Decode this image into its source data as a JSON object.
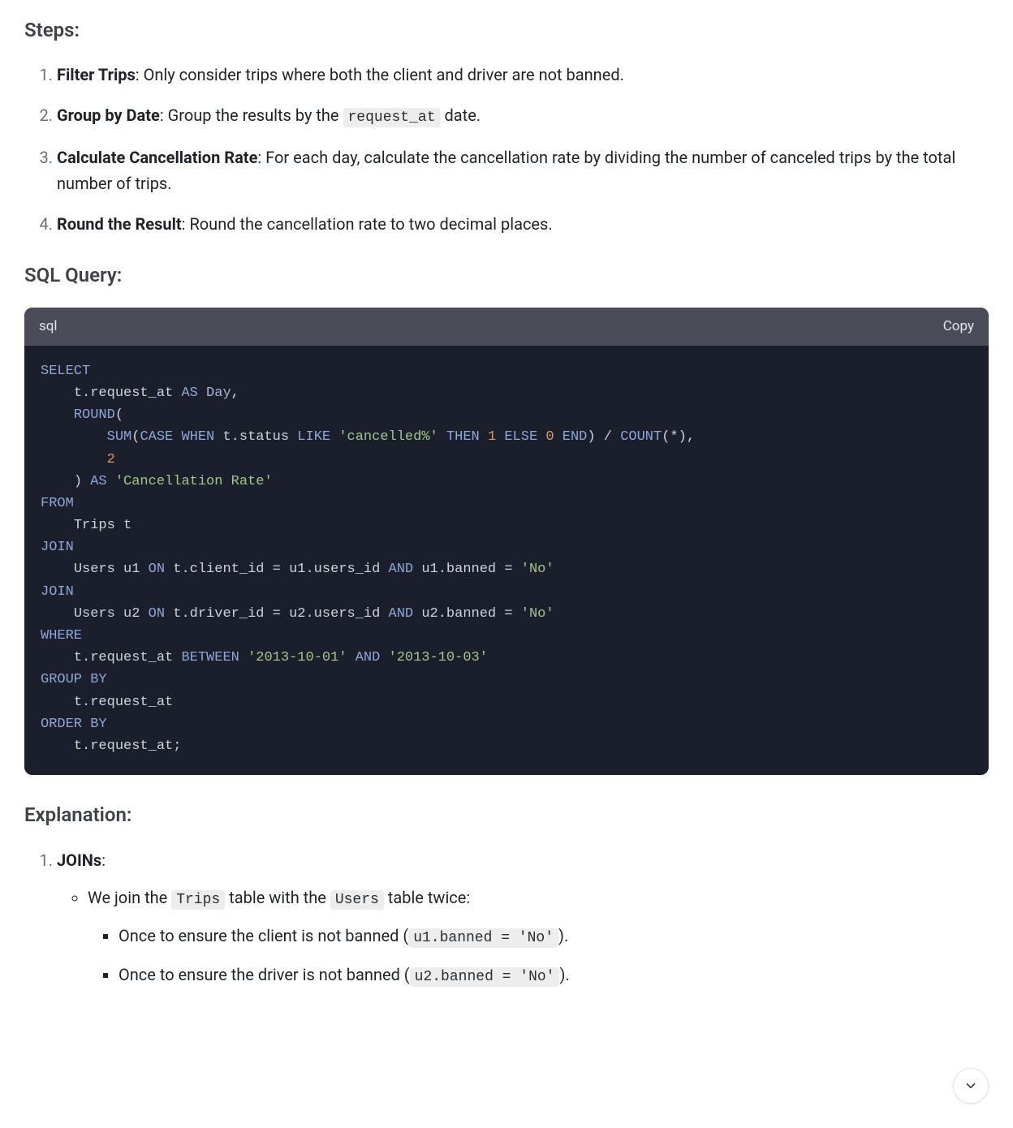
{
  "headings": {
    "steps": "Steps:",
    "sql_query": "SQL Query:",
    "explanation": "Explanation:"
  },
  "steps": [
    {
      "title": "Filter Trips",
      "rest": ": Only consider trips where both the client and driver are not banned."
    },
    {
      "title": "Group by Date",
      "prefix": ": Group the results by the ",
      "code": "request_at",
      "suffix": " date."
    },
    {
      "title": "Calculate Cancellation Rate",
      "rest": ": For each day, calculate the cancellation rate by dividing the number of canceled trips by the total number of trips."
    },
    {
      "title": "Round the Result",
      "rest": ": Round the cancellation rate to two decimal places."
    }
  ],
  "code": {
    "lang": "sql",
    "copy_label": "Copy",
    "tokens": {
      "select": "SELECT",
      "as1": "AS",
      "day": "Day",
      "round": "ROUND",
      "sum": "SUM",
      "case": "CASE",
      "when": "WHEN",
      "like": "LIKE",
      "then": "THEN",
      "else": "ELSE",
      "end": "END",
      "count": "COUNT",
      "from": "FROM",
      "join1": "JOIN",
      "on1": "ON",
      "and1": "AND",
      "join2": "JOIN",
      "on2": "ON",
      "and2": "AND",
      "where": "WHERE",
      "between": "BETWEEN",
      "and3": "AND",
      "groupby": "GROUP BY",
      "orderby": "ORDER BY",
      "t_request_at": "t.request_at",
      "t_status": "t.status",
      "trips": "Trips t",
      "users_u1": "Users u1",
      "users_u2": "Users u2",
      "t_client_id": "t.client_id",
      "u1_users_id": "u1.users_id",
      "u1_banned": "u1.banned",
      "t_driver_id": "t.driver_id",
      "u2_users_id": "u2.users_id",
      "u2_banned": "u2.banned",
      "str_cancelled": "'cancelled%'",
      "str_no": "'No'",
      "str_cr": "'Cancellation Rate'",
      "str_d1": "'2013-10-01'",
      "str_d2": "'2013-10-03'",
      "num_1": "1",
      "num_0": "0",
      "num_2": "2",
      "star": "*",
      "comma": ",",
      "lparen": "(",
      "rparen": ")",
      "eq": "=",
      "slash": "/",
      "semi": ";"
    }
  },
  "explanation": {
    "item1_title": "JOINs",
    "item1_colon": ":",
    "sub1_prefix": "We join the ",
    "sub1_code1": "Trips",
    "sub1_mid": " table with the ",
    "sub1_code2": "Users",
    "sub1_suffix": " table twice:",
    "sub2a_prefix": "Once to ensure the client is not banned (",
    "sub2a_code": "u1.banned = 'No'",
    "sub2a_suffix": ").",
    "sub2b_prefix": "Once to ensure the driver is not banned (",
    "sub2b_code": "u2.banned = 'No'",
    "sub2b_suffix": ")."
  }
}
